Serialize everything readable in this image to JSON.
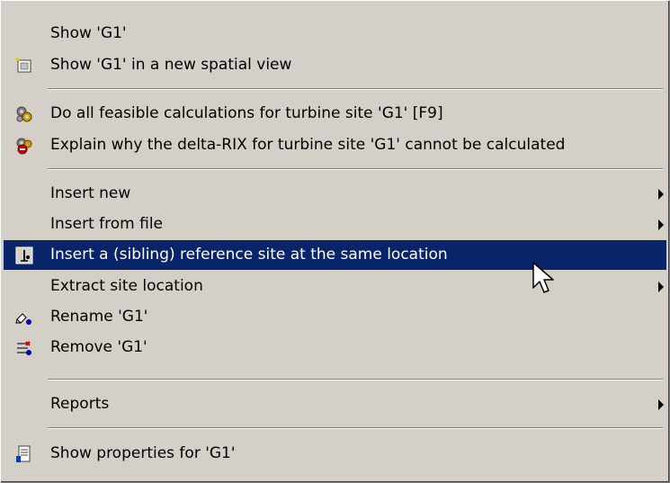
{
  "menu": {
    "show": "Show 'G1'",
    "show_new_view": "Show 'G1' in a new spatial view",
    "do_all_calculations": "Do all feasible calculations for turbine site 'G1' [F9]",
    "explain_delta_rix": "Explain why the delta-RIX for turbine site 'G1' cannot be calculated",
    "insert_new": "Insert new",
    "insert_from_file": "Insert from file",
    "insert_reference_site": "Insert a (sibling) reference site at the same location",
    "extract_site_location": "Extract site location",
    "rename": "Rename 'G1'",
    "remove": "Remove 'G1'",
    "reports": "Reports",
    "show_properties": "Show properties for 'G1'"
  },
  "colors": {
    "menu_background": "#d4d0c8",
    "selection_background": "#0a246a",
    "selection_text": "#ffffff"
  },
  "icons": [
    "new-view-icon",
    "calculate-gears-icon",
    "explain-error-gears-icon",
    "reference-site-icon",
    "rename-pencil-icon",
    "remove-icon",
    "properties-icon",
    "submenu-arrow-icon",
    "mouse-cursor-icon"
  ]
}
